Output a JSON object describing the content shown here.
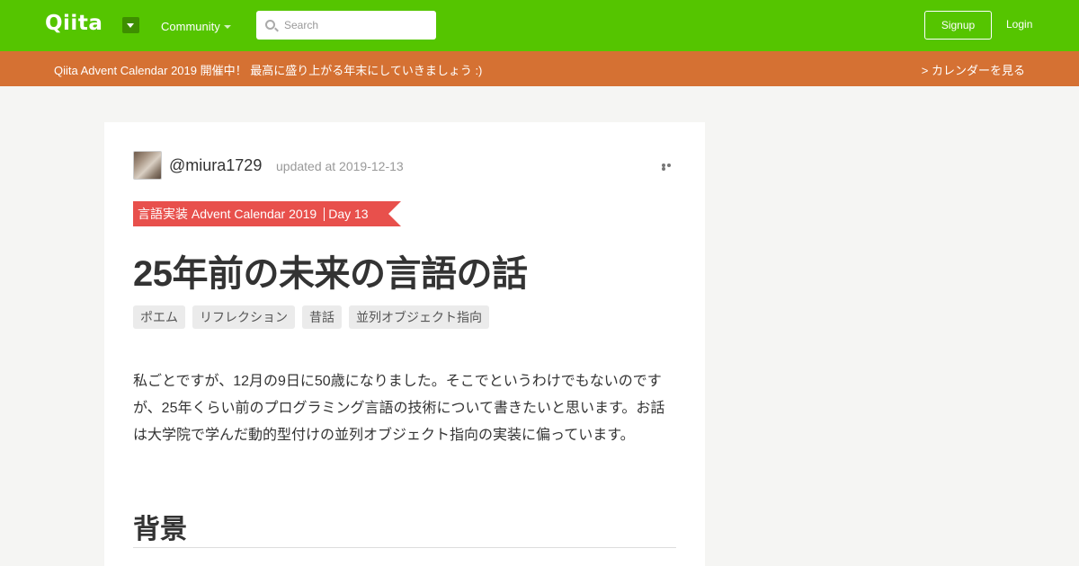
{
  "header": {
    "logo": "Qiita",
    "community_label": "Community",
    "search_placeholder": "Search",
    "signup_label": "Signup",
    "login_label": "Login"
  },
  "banner": {
    "text": "Qiita Advent Calendar 2019 開催中！ 最高に盛り上がる年末にしていきましょう :)",
    "link": "> カレンダーを見る"
  },
  "article": {
    "author": "@miura1729",
    "updated": "updated at 2019-12-13",
    "calendar_name": "言語実装 Advent Calendar 2019",
    "calendar_day": "Day 13",
    "title": "25年前の未来の言語の話",
    "tags": [
      "ポエム",
      "リフレクション",
      "昔話",
      "並列オブジェクト指向"
    ],
    "body": "私ごとですが、12月の9日に50歳になりました。そこでというわけでもないのですが、25年くらい前のプログラミング言語の技術について書きたいと思います。お話は大学院で学んだ動的型付けの並列オブジェクト指向の実装に偏っています。",
    "section_heading": "背景"
  },
  "colors": {
    "header_green": "#55c500",
    "banner_orange": "#d57133",
    "ribbon_red": "#e8504c"
  }
}
